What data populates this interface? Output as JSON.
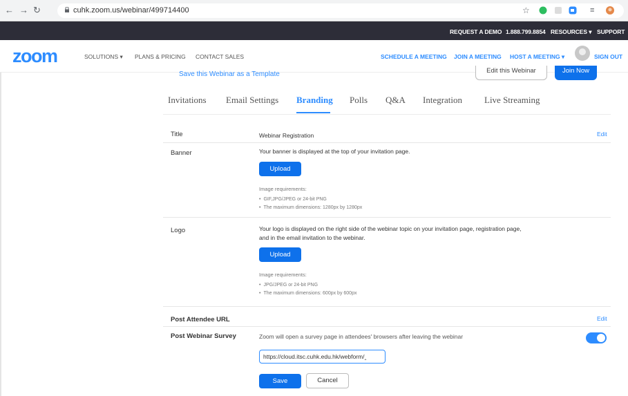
{
  "browser": {
    "back_icon": "back-arrow-icon",
    "forward_icon": "forward-arrow-icon",
    "reload_icon": "reload-icon",
    "url": "cuhk.zoom.us/webinar/499714400"
  },
  "topbar": {
    "request_demo": "REQUEST A DEMO",
    "phone": "1.888.799.8854",
    "resources": "RESOURCES ▾",
    "support": "SUPPORT"
  },
  "header": {
    "logo": "zoom",
    "solutions": "SOLUTIONS ▾",
    "plans": "PLANS & PRICING",
    "contact": "CONTACT SALES",
    "schedule": "SCHEDULE A MEETING",
    "join": "JOIN A MEETING",
    "host": "HOST A MEETING ▾",
    "sign_out": "SIGN OUT"
  },
  "actions": {
    "template_link": "Save this Webinar as a Template",
    "edit_webinar": "Edit this Webinar",
    "join_now": "Join Now"
  },
  "tabs": [
    "Invitations",
    "Email Settings",
    "Branding",
    "Polls",
    "Q&A",
    "Integration",
    "Live Streaming"
  ],
  "branding": {
    "title_label": "Title",
    "title_value": "Webinar Registration",
    "edit": "Edit",
    "banner_label": "Banner",
    "banner_desc": "Your banner is displayed at the top of your invitation page.",
    "upload": "Upload",
    "image_req": "Image requirements:",
    "banner_req": [
      "GIF,JPG/JPEG or 24-bit PNG",
      "The maximum dimensions: 1280px by 1280px"
    ],
    "logo_label": "Logo",
    "logo_desc_1": "Your logo is displayed on the right side of the webinar topic on your invitation page, registration page,",
    "logo_desc_2": "and in the email invitation to the webinar.",
    "logo_req": [
      "JPG/JPEG or 24-bit PNG",
      "The maximum dimensions: 600px by 600px"
    ],
    "post_attendee_label": "Post Attendee URL",
    "post_survey_label": "Post Webinar Survey",
    "post_survey_desc": "Zoom will open a survey page in attendees' browsers after leaving the webinar",
    "survey_enabled": true,
    "survey_url": "https://cloud.itsc.cuhk.edu.hk/webform/‸",
    "save": "Save",
    "cancel": "Cancel"
  },
  "colors": {
    "accent": "#2d8cff",
    "button": "#0e71eb",
    "topbar": "#2d2d38"
  }
}
